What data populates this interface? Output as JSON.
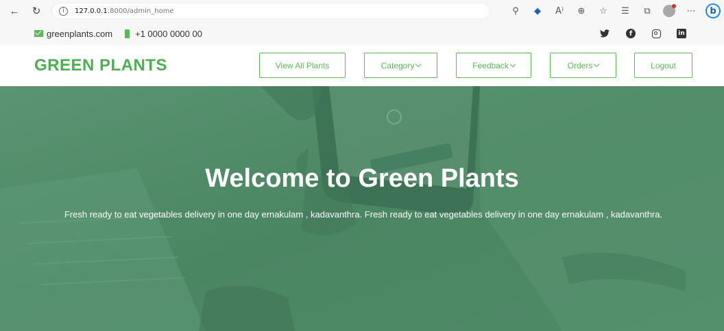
{
  "browser": {
    "url_host": "127.0.0.1",
    "url_path": ":8000/admin_home"
  },
  "topbar": {
    "email": "greenplants.com",
    "phone": "+1 0000 0000 00"
  },
  "header": {
    "brand": "GREEN PLANTS",
    "nav": {
      "view_all_plants": "View All Plants",
      "category": "Category",
      "feedback": "Feedback",
      "orders": "Orders",
      "logout": "Logout"
    }
  },
  "hero": {
    "title": "Welcome to Green Plants",
    "text": "Fresh ready to eat vegetables delivery in one day ernakulam , kadavanthra. Fresh ready to eat vegetables delivery in one day ernakulam , kadavanthra."
  },
  "colors": {
    "brand_green": "#4caf50",
    "hero_overlay": "#4e8a66"
  }
}
